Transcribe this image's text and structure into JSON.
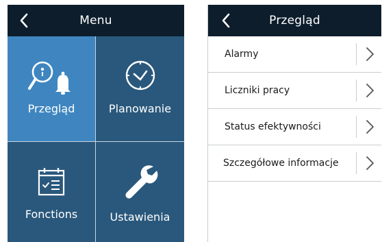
{
  "menu_screen": {
    "header": {
      "title": "Menu",
      "back_icon": "chevron-left-icon"
    },
    "tiles": [
      {
        "label": "Przegląd",
        "icon": "search-bell-icon",
        "selected": true
      },
      {
        "label": "Planowanie",
        "icon": "clock-icon",
        "selected": false
      },
      {
        "label": "Fonctions",
        "icon": "calendar-list-icon",
        "selected": false
      },
      {
        "label": "Ustawienia",
        "icon": "wrench-icon",
        "selected": false
      }
    ]
  },
  "overview_screen": {
    "header": {
      "title": "Przegląd",
      "back_icon": "chevron-left-icon"
    },
    "items": [
      {
        "label": "Alarmy",
        "icon": "chevron-right-icon"
      },
      {
        "label": "Liczniki pracy",
        "icon": "chevron-right-icon"
      },
      {
        "label": "Status efektywności",
        "icon": "chevron-right-icon"
      },
      {
        "label": "Szczegółowe informacje",
        "icon": "chevron-right-icon"
      }
    ]
  },
  "colors": {
    "header_bg": "#0d1d2c",
    "tile_bg": "#2a587c",
    "tile_selected_bg": "#3f86c0",
    "divider": "#c8ccd0"
  }
}
